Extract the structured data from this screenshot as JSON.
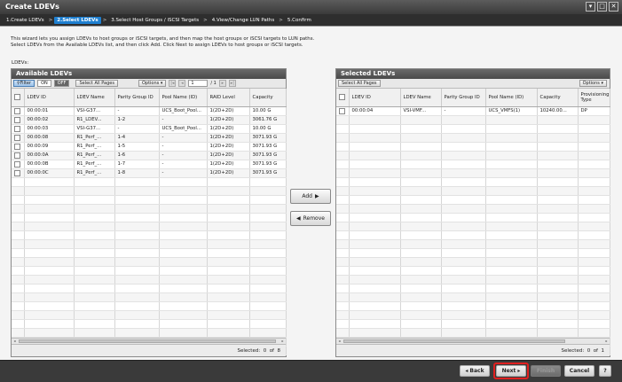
{
  "window": {
    "title": "Create LDEVs"
  },
  "steps": [
    {
      "label": "1.Create LDEVs",
      "active": false
    },
    {
      "label": "2.Select LDEVs",
      "active": true
    },
    {
      "label": "3.Select Host Groups / iSCSI Targets",
      "active": false
    },
    {
      "label": "4.View/Change LUN Paths",
      "active": false
    },
    {
      "label": "5.Confirm",
      "active": false
    }
  ],
  "instructions": [
    "This wizard lets you assign LDEVs to host groups or iSCSI targets, and then map the host groups or iSCSI targets to LUN paths.",
    "Select LDEVs from the Available LDEVs list, and then click Add. Click Next to assign LDEVs to host groups or iSCSI targets."
  ],
  "ldevs_label": "LDEVs:",
  "available": {
    "title": "Available LDEVs",
    "filter_label": "Filter",
    "on_label": "ON",
    "off_label": "OFF",
    "select_all_label": "Select All Pages",
    "options_label": "Options",
    "page_current": "1",
    "page_total": "/ 1",
    "columns": [
      "LDEV ID",
      "LDEV Name",
      "Parity Group ID",
      "Pool Name (ID)",
      "RAID Level",
      "Capacity"
    ],
    "rows": [
      [
        "00:00:01",
        "VSI-G37...",
        "-",
        "UCS_Boot_Pool...",
        "1(2D+2D)",
        "10.00 G"
      ],
      [
        "00:00:02",
        "R1_LDEV...",
        "1-2",
        "-",
        "1(2D+2D)",
        "3061.76 G"
      ],
      [
        "00:00:03",
        "VSI-G37...",
        "-",
        "UCS_Boot_Pool...",
        "1(2D+2D)",
        "10.00 G"
      ],
      [
        "00:00:08",
        "R1_Perf_...",
        "1-4",
        "-",
        "1(2D+2D)",
        "3071.93 G"
      ],
      [
        "00:00:09",
        "R1_Perf_...",
        "1-5",
        "-",
        "1(2D+2D)",
        "3071.93 G"
      ],
      [
        "00:00:0A",
        "R1_Perf_...",
        "1-6",
        "-",
        "1(2D+2D)",
        "3071.93 G"
      ],
      [
        "00:00:0B",
        "R1_Perf_...",
        "1-7",
        "-",
        "1(2D+2D)",
        "3071.93 G"
      ],
      [
        "00:00:0C",
        "R1_Perf_...",
        "1-8",
        "-",
        "1(2D+2D)",
        "3071.93 G"
      ]
    ],
    "selected_label": "Selected:",
    "selected_count": "0",
    "of_label": "of",
    "total_count": "8"
  },
  "middle": {
    "add_label": "Add",
    "remove_label": "Remove"
  },
  "selected": {
    "title": "Selected LDEVs",
    "select_all_label": "Select All Pages",
    "options_label": "Options",
    "columns": [
      "LDEV ID",
      "LDEV Name",
      "Parity Group ID",
      "Pool Name (ID)",
      "Capacity",
      "Provisioning Type"
    ],
    "rows": [
      [
        "00:00:04",
        "VSI-VMF...",
        "-",
        "UCS_VMFS(1)",
        "10240.00...",
        "DP"
      ]
    ],
    "selected_label": "Selected:",
    "selected_count": "0",
    "of_label": "of",
    "total_count": "1"
  },
  "footer": {
    "back_label": "Back",
    "next_label": "Next",
    "finish_label": "Finish",
    "cancel_label": "Cancel",
    "help_label": "?"
  },
  "colors": {
    "accent": "#1e7fd0",
    "highlight": "#e02020"
  }
}
